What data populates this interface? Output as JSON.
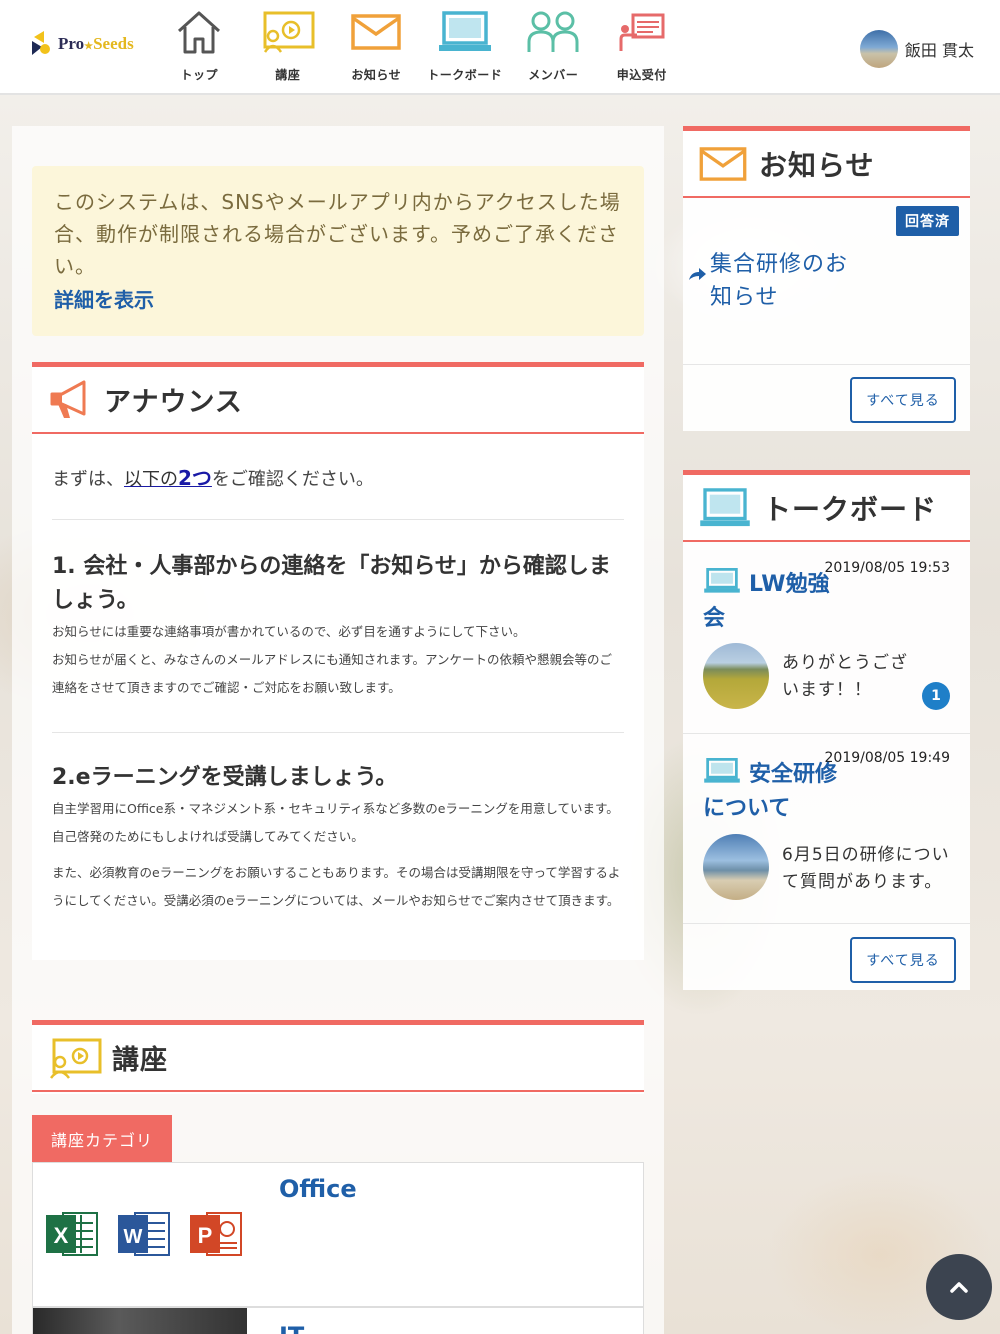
{
  "brand": {
    "name_left": "Pro",
    "name_right": "Seeds"
  },
  "nav": [
    {
      "label": "トップ",
      "icon": "home-icon"
    },
    {
      "label": "講座",
      "icon": "course-board-icon"
    },
    {
      "label": "お知らせ",
      "icon": "mail-icon"
    },
    {
      "label": "トークボード",
      "icon": "laptop-icon"
    },
    {
      "label": "メンバー",
      "icon": "members-icon"
    },
    {
      "label": "申込受付",
      "icon": "application-icon"
    }
  ],
  "user": {
    "name": "飯田 貫太"
  },
  "notice": {
    "text": "このシステムは、SNSやメールアプリ内からアクセスした場合、動作が制限される場合がございます。予めご了承ください。",
    "link": "詳細を表示"
  },
  "announce": {
    "title": "アナウンス",
    "intro_before": "まずは、",
    "intro_link_text": "以下の",
    "intro_link_bold": "2つ",
    "intro_after": "をご確認ください。",
    "item1_title": "1. 会社・人事部からの連絡を「お知らせ」から確認しましょう。",
    "item1_p1": "お知らせには重要な連絡事項が書かれているので、必ず目を通すようにして下さい。",
    "item1_p2": "お知らせが届くと、みなさんのメールアドレスにも通知されます。アンケートの依頼や懇親会等のご連絡をさせて頂きますのでご確認・ご対応をお願い致します。",
    "item2_title": "2.eラーニングを受講しましょう。",
    "item2_p1": "自主学習用にOffice系・マネジメント系・セキュリティ系など多数のeラーニングを用意しています。自己啓発のためにもしよければ受講してみてください。",
    "item2_p2": "また、必須教育のeラーニングをお願いすることもあります。その場合は受講期限を守って学習するようにしてください。受講必須のeラーニングについては、メールやお知らせでご案内させて頂きます。"
  },
  "courses": {
    "title": "講座",
    "category_tab": "講座カテゴリ",
    "categories": [
      {
        "name": "Office",
        "icons": [
          "excel-icon",
          "word-icon",
          "powerpoint-icon"
        ]
      },
      {
        "name": "IT"
      }
    ]
  },
  "news": {
    "title": "お知らせ",
    "badge": "回答済",
    "item": "集合研修のお知らせ",
    "see_all": "すべて見る"
  },
  "talkboard": {
    "title": "トークボード",
    "items": [
      {
        "title": "LW勉強会",
        "date": "2019/08/05 19:53",
        "message": "ありがとうございます！！",
        "count": "1"
      },
      {
        "title": "安全研修について",
        "date": "2019/08/05 19:49",
        "message": "6月5日の研修について質問があります。"
      }
    ],
    "see_all": "すべて見る"
  },
  "colors": {
    "accent": "#f06a63",
    "link": "#1f5fa8",
    "notice_bg": "#fcf6da"
  }
}
